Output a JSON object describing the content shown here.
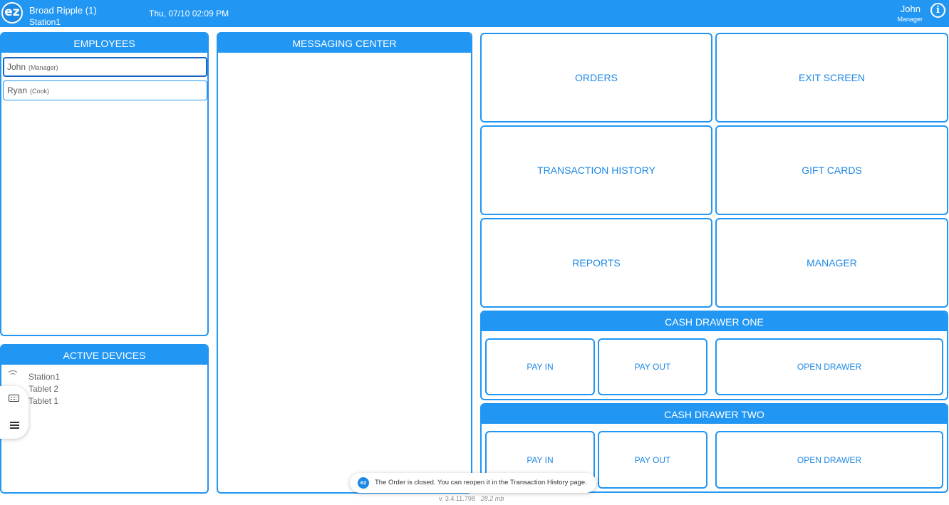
{
  "header": {
    "logo_text": "ez",
    "store_name": "Broad Ripple (1)",
    "station": "Station1",
    "datetime": "Thu, 07/10 02:09 PM",
    "user_name": "John",
    "user_role": "Manager",
    "info_icon": "i"
  },
  "employees": {
    "title": "EMPLOYEES",
    "items": [
      {
        "name": "John",
        "role": "(Manager)",
        "selected": true
      },
      {
        "name": "Ryan",
        "role": "(Cook)",
        "selected": false
      }
    ]
  },
  "devices": {
    "title": "ACTIVE DEVICES",
    "items": [
      "Station1",
      "Tablet 2",
      "Tablet 1"
    ]
  },
  "messaging": {
    "title": "MESSAGING CENTER"
  },
  "tiles": {
    "orders": "ORDERS",
    "exit_screen": "EXIT SCREEN",
    "transaction_history": "TRANSACTION HISTORY",
    "gift_cards": "GIFT CARDS",
    "reports": "REPORTS",
    "manager": "MANAGER"
  },
  "drawer_one": {
    "title": "CASH DRAWER ONE",
    "pay_in": "PAY IN",
    "pay_out": "PAY OUT",
    "open_drawer": "OPEN DRAWER"
  },
  "drawer_two": {
    "title": "CASH DRAWER TWO",
    "pay_in": "PAY IN",
    "pay_out": "PAY OUT",
    "open_drawer": "OPEN DRAWER"
  },
  "toast": {
    "logo_text": "ez",
    "message": "The Order is closed. You can reopen it in the Transaction History page."
  },
  "footer": {
    "version": "v. 3.4.11.798",
    "memory": "28.2 mb"
  },
  "colors": {
    "primary": "#2196f3",
    "tile_text": "#1e88e5"
  }
}
